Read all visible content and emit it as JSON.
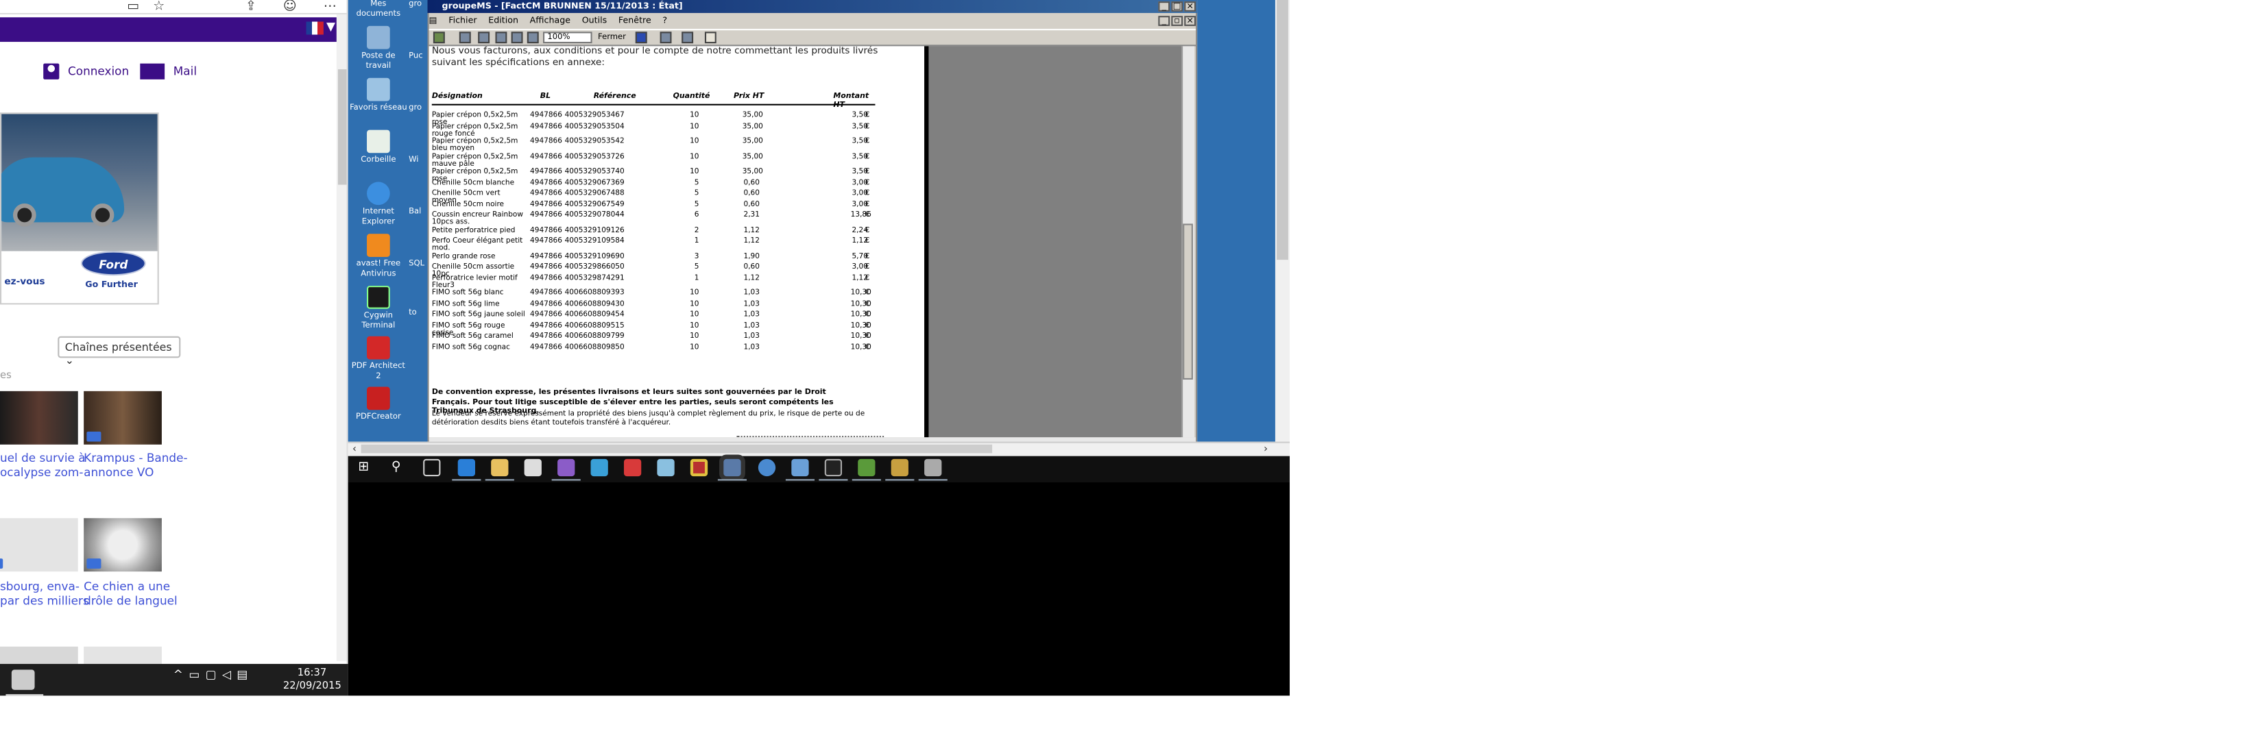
{
  "browser": {
    "connexion": "Connexion",
    "mail": "Mail",
    "ad_left_text": "ez-vous",
    "ad_brand": "Ford",
    "ad_slogan": "Go Further",
    "chaines": "Chaînes présentées",
    "section_text": "es",
    "videos": [
      {
        "caption": "uel de survie à\nocalypse zom-"
      },
      {
        "caption": "Krampus - Bande-\nannonce VO"
      },
      {
        "caption": "sbourg, enva-\npar des milliers"
      },
      {
        "caption": "Ce chien a une\ndrôle de languel"
      }
    ]
  },
  "clock": {
    "time": "16:37",
    "date": "22/09/2015"
  },
  "desktop": {
    "top_label": "Mes documents",
    "top_label2": "gro",
    "icons": [
      {
        "label": "Poste de travail",
        "side": "Puc"
      },
      {
        "label": "Favoris réseau",
        "side": "gro"
      },
      {
        "label": "Corbeille",
        "side": "Wi"
      },
      {
        "label": "Internet Explorer",
        "side": "Bal"
      },
      {
        "label": "avast! Free Antivirus",
        "side": "SQL"
      },
      {
        "label": "Cygwin Terminal",
        "side": "to"
      },
      {
        "label": "PDF Architect 2",
        "side": ""
      },
      {
        "label": "PDFCreator",
        "side": ""
      }
    ]
  },
  "app": {
    "title": "groupeMS - [FactCM BRUNNEN 15/11/2013 : État]",
    "menus": [
      "Fichier",
      "Edition",
      "Affichage",
      "Outils",
      "Fenêtre",
      "?"
    ],
    "zoom": "100%",
    "close_label": "Fermer",
    "intro": "Nous vous facturons, aux conditions et pour le compte de notre commettant les produits livrés suivant les spécifications en annexe:",
    "headers": [
      "Désignation",
      "BL",
      "Référence",
      "Quantité",
      "Prix HT",
      "Montant HT"
    ],
    "rows": [
      [
        "Papier crépon 0,5x2,5m rose",
        "4947866",
        "4005329053467",
        "10",
        "35,00",
        "3,50",
        "€"
      ],
      [
        "Papier crépon 0,5x2,5m rouge foncé",
        "4947866",
        "4005329053504",
        "10",
        "35,00",
        "3,50",
        "€"
      ],
      [
        "Papier crépon 0,5x2,5m bleu moyen",
        "4947866",
        "4005329053542",
        "10",
        "35,00",
        "3,50",
        "€"
      ],
      [
        "Papier crépon 0,5x2,5m mauve pâle",
        "4947866",
        "4005329053726",
        "10",
        "35,00",
        "3,50",
        "€"
      ],
      [
        "Papier crépon 0,5x2,5m rose",
        "4947866",
        "4005329053740",
        "10",
        "35,00",
        "3,50",
        "€"
      ],
      [
        "Chenille 50cm blanche",
        "4947866",
        "4005329067369",
        "5",
        "0,60",
        "3,00",
        "€"
      ],
      [
        "Chenille 50cm vert moyen",
        "4947866",
        "4005329067488",
        "5",
        "0,60",
        "3,00",
        "€"
      ],
      [
        "Chenille 50cm noire",
        "4947866",
        "4005329067549",
        "5",
        "0,60",
        "3,00",
        "€"
      ],
      [
        "Coussin encreur Rainbow 10pcs ass.",
        "4947866",
        "4005329078044",
        "6",
        "2,31",
        "13,86",
        "€"
      ],
      [
        "Petite perforatrice pied",
        "4947866",
        "4005329109126",
        "2",
        "1,12",
        "2,24",
        "€"
      ],
      [
        "Perfo Coeur élégant petit mod.",
        "4947866",
        "4005329109584",
        "1",
        "1,12",
        "1,12",
        "€"
      ],
      [
        "Perlo grande rose",
        "4947866",
        "4005329109690",
        "3",
        "1,90",
        "5,70",
        "€"
      ],
      [
        "Chenille 50cm assortie 10pc",
        "4947866",
        "4005329866050",
        "5",
        "0,60",
        "3,00",
        "€"
      ],
      [
        "Perforatrice levier motif Fleur3",
        "4947866",
        "4005329874291",
        "1",
        "1,12",
        "1,12",
        "€"
      ],
      [
        "FIMO soft 56g blanc",
        "4947866",
        "4006608809393",
        "10",
        "1,03",
        "10,30",
        "€"
      ],
      [
        "FIMO soft 56g lime",
        "4947866",
        "4006608809430",
        "10",
        "1,03",
        "10,30",
        "€"
      ],
      [
        "FIMO soft 56g jaune soleil",
        "4947866",
        "4006608809454",
        "10",
        "1,03",
        "10,30",
        "€"
      ],
      [
        "FIMO soft 56g rouge cerise",
        "4947866",
        "4006608809515",
        "10",
        "1,03",
        "10,30",
        "€"
      ],
      [
        "FIMO soft 56g caramel",
        "4947866",
        "4006608809799",
        "10",
        "1,03",
        "10,30",
        "€"
      ],
      [
        "FIMO soft 56g cognac",
        "4947866",
        "4006608809850",
        "10",
        "1,03",
        "10,30",
        "€"
      ]
    ],
    "footer_bold": "De convention expresse, les présentes livraisons et leurs suites sont gouvernées par le Droit Français. Pour tout litige susceptible de s'élever entre les parties, seuls seront compétents les Tribunaux de Strasbourg.",
    "footer_normal": "Le vendeur se réserve expressément la propriété des biens jusqu'à complet règlement du prix, le risque de perte ou de détérioration desdits biens étant toutefois transféré à l'acquéreur."
  },
  "colors": {
    "brand": "#3b0d86",
    "desktop": "#2f6fb0",
    "titlebar": "#0a246a",
    "link": "#3f51d6"
  }
}
